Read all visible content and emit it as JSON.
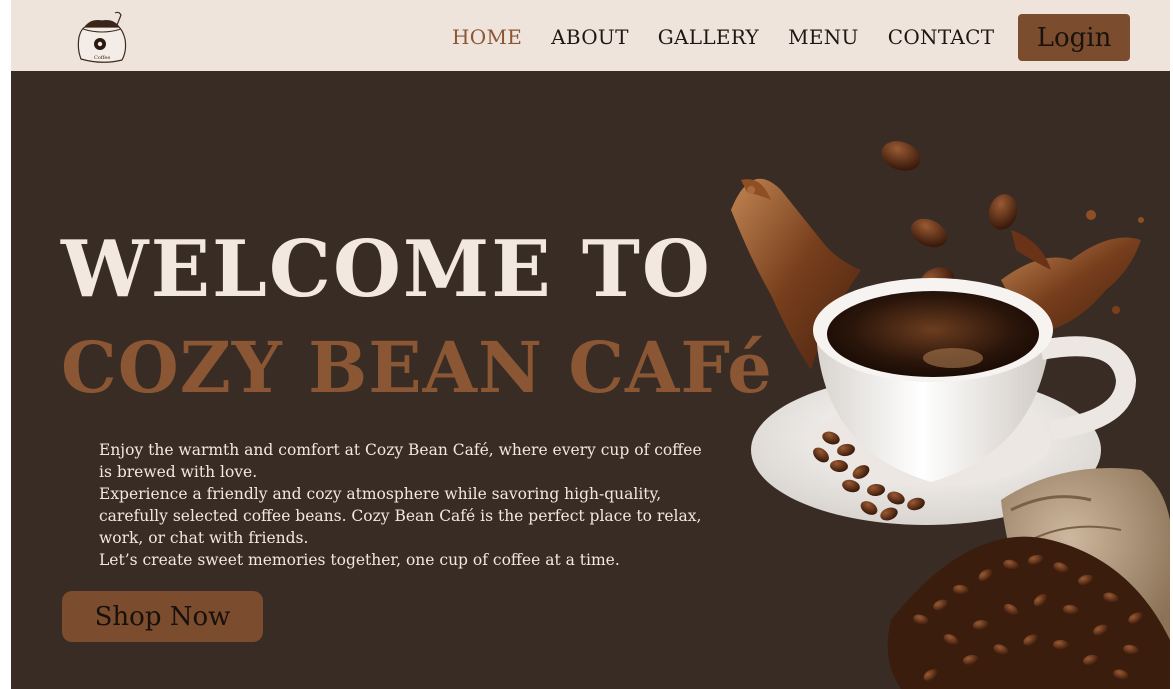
{
  "nav": {
    "logo_icon": "coffee-bag-logo-icon",
    "links": [
      "HOME",
      "ABOUT",
      "GALLERY",
      "MENU",
      "CONTACT"
    ],
    "active": "HOME",
    "login_label": "Login"
  },
  "hero": {
    "title_line1": "WELCOME TO",
    "title_line2": "COZY BEAN CAFé",
    "paragraph1": "Enjoy the warmth and comfort at Cozy Bean Café, where every cup of coffee is brewed with love.",
    "paragraph2": "Experience a friendly and cozy atmosphere while savoring high-quality, carefully selected coffee beans. Cozy Bean Café is the perfect place to relax, work, or chat with friends.",
    "paragraph3": "Let’s create sweet memories together, one cup of coffee at a time.",
    "cta_label": "Shop Now",
    "image_icon": "coffee-cup-splash-icon"
  },
  "colors": {
    "nav_bg": "#efe4db",
    "hero_bg": "#382c24",
    "accent": "#8a5633",
    "button": "#7b4c2d",
    "light_text": "#f2e8df"
  }
}
